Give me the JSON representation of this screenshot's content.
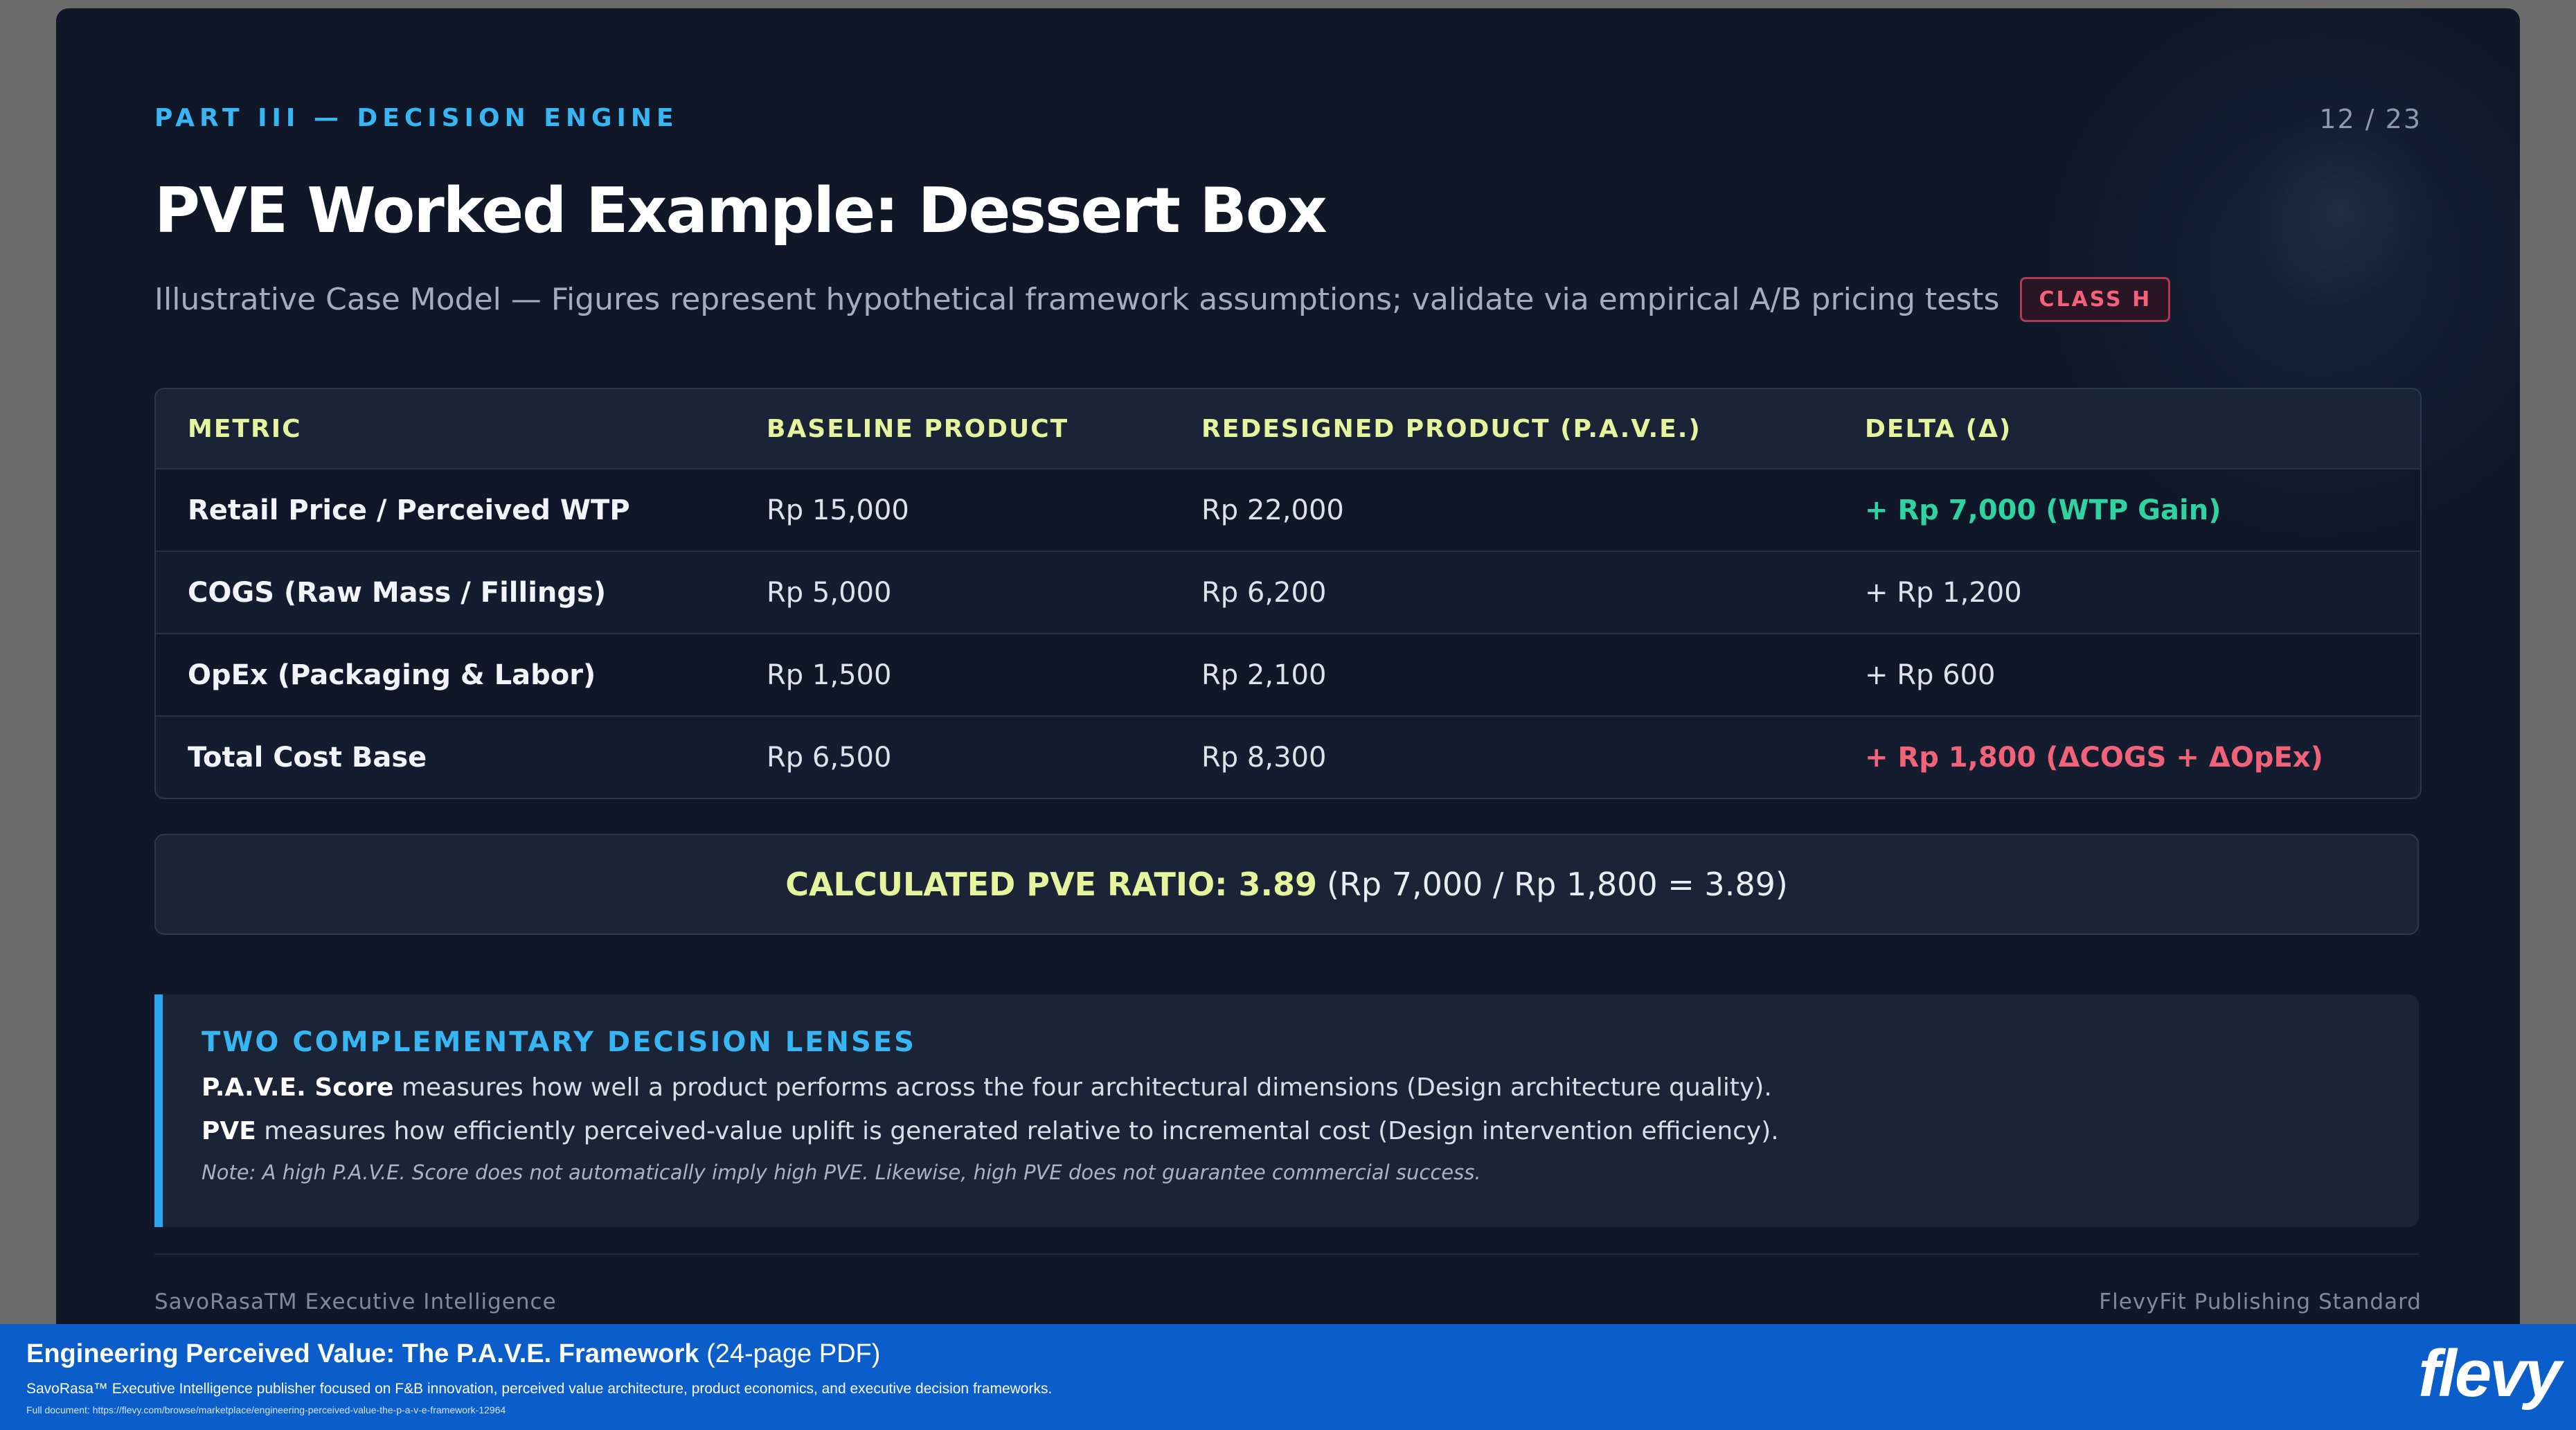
{
  "slide": {
    "kicker": "PART III — DECISION ENGINE",
    "page_number": "12 / 23",
    "title": "PVE Worked Example: Dessert Box",
    "subtitle": "Illustrative Case Model — Figures represent hypothetical framework assumptions; validate via empirical A/B pricing tests",
    "badge": "CLASS H"
  },
  "table": {
    "headers": [
      "METRIC",
      "BASELINE PRODUCT",
      "REDESIGNED PRODUCT (P.A.V.E.)",
      "DELTA (Δ)"
    ],
    "rows": [
      {
        "metric": "Retail Price / Perceived WTP",
        "baseline": "Rp 15,000",
        "redesigned": "Rp 22,000",
        "delta": "+ Rp 7,000 (WTP Gain)"
      },
      {
        "metric": "COGS (Raw Mass / Fillings)",
        "baseline": "Rp 5,000",
        "redesigned": "Rp 6,200",
        "delta": "+ Rp 1,200"
      },
      {
        "metric": "OpEx (Packaging & Labor)",
        "baseline": "Rp 1,500",
        "redesigned": "Rp 2,100",
        "delta": "+ Rp 600"
      },
      {
        "metric": "Total Cost Base",
        "baseline": "Rp 6,500",
        "redesigned": "Rp 8,300",
        "delta": "+ Rp 1,800 (ΔCOGS + ΔOpEx)"
      }
    ]
  },
  "ratio": {
    "label": "CALCULATED PVE RATIO: 3.89",
    "calc": "(Rp 7,000 / Rp 1,800 = 3.89)"
  },
  "lens": {
    "title": "TWO COMPLEMENTARY DECISION LENSES",
    "line1_term": "P.A.V.E. Score",
    "line1_text": " measures how well a product performs across the four architectural dimensions (Design architecture quality).",
    "line2_term": "PVE",
    "line2_text": " measures how efficiently perceived-value uplift is generated relative to incremental cost (Design intervention efficiency).",
    "note": "Note: A high P.A.V.E. Score does not automatically imply high PVE. Likewise, high PVE does not guarantee commercial success."
  },
  "footer": {
    "left": "SavoRasaTM Executive Intelligence",
    "right": "FlevyFit Publishing Standard"
  },
  "banner": {
    "title": "Engineering Perceived Value: The P.A.V.E. Framework",
    "title_suffix": " (24-page PDF)",
    "description": "SavoRasa™ Executive Intelligence publisher focused on F&B innovation, perceived value architecture, product economics, and executive decision frameworks.",
    "url": "Full document: https://flevy.com/browse/marketplace/engineering-perceived-value-the-p-a-v-e-framework-12964",
    "logo": "flevy"
  },
  "colors": {
    "background": "#0f1729",
    "accent_blue": "#38b6f4",
    "header_lime": "#e4f59e",
    "gain_green": "#2fd3a0",
    "cost_red": "#f2637a",
    "banner_blue": "#0b5ec9"
  }
}
